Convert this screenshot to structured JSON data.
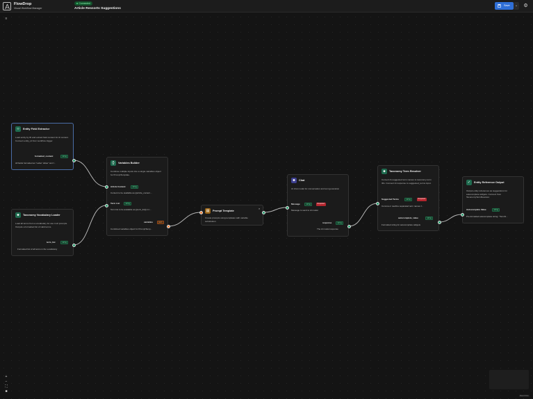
{
  "app": {
    "title": "FlowDrop",
    "subtitle": "Visual Workflow Manager"
  },
  "header": {
    "status": "Connected",
    "workflow_title": "Article Ressorts Suggestions",
    "save_label": "Save",
    "more_icon": "chevron-down-icon",
    "settings_icon": "gear-icon"
  },
  "colors": {
    "accent": "#2f6fd6",
    "connected": "#4ade80",
    "string_port": "#2ba271",
    "json_port": "#f0833a",
    "required": "#b3262e",
    "node_border": "#333333"
  },
  "nodes": {
    "entity_field_extractor": {
      "title": "Entity Field Extractor",
      "icon": "code-icon",
      "description": "Load entity by ID and extract field content for AI context. Connect entity_id from workflow trigger.",
      "output_label": "formatted_content",
      "output_type": "string",
      "output_desc": "All fields formatted as \"Label: Value\" text f..."
    },
    "taxonomy_vocabulary_loader": {
      "title": "Taxonomy Vocabulary Loader",
      "icon": "tag-icon",
      "description": "Load all terms from a vocabulary for use in AI prompts. Outputs a formatted list of valid terms.",
      "output_label": "term_list",
      "output_type": "string",
      "output_desc": "Formatted list of all terms in the vocabulary"
    },
    "variables_builder": {
      "title": "Variables Builder",
      "icon": "braces-icon",
      "description": "Combine multiple inputs into a single variables object for PromptTemplate.",
      "input1_label": "Article Content",
      "input1_type": "string",
      "input1_desc": "Content to be available as {{article_content...",
      "input2_label": "Term List",
      "input2_type": "string",
      "input2_desc": "Term list to be available as {{term_list}} in t...",
      "output_label": "variables",
      "output_type": "json",
      "output_desc": "Combined variables object for PromptTemp..."
    },
    "prompt_template": {
      "title": "Prompt Template",
      "icon": "template-icon",
      "close_icon": "close-icon",
      "description": "Create prompts using templates with variable substitution"
    },
    "chat": {
      "title": "Chat",
      "icon": "robot-icon",
      "description": "AI chat model for conversation and text generation",
      "input_label": "Message",
      "input_type": "string",
      "input_required": "Required",
      "input_desc": "Message to send to AI model",
      "output_label": "response",
      "output_type": "string",
      "output_desc": "The AI model response"
    },
    "taxonomy_term_resolver": {
      "title": "Taxonomy Term Resolver",
      "icon": "tags-icon",
      "description": "Convert AI-suggested term names to taxonomy term IDs. Connect AI response to suggested_terms input.",
      "input_label": "Suggested Terms",
      "input_type": "string",
      "input_required": "Required",
      "input_desc": "Comma or newline separated term names f...",
      "output_label": "autocomplete_value",
      "output_type": "string",
      "output_desc": "Formatted string for autocomplete widgets"
    },
    "entity_reference_output": {
      "title": "Entity Reference Output",
      "icon": "check-square-icon",
      "description": "Output entity references as suggestions for autocomplete widgets. Connect from TaxonomyTermResolver.",
      "input_label": "Autocomplete Value",
      "input_type": "string",
      "input_desc": "Pre-formatted autocomplete string: \"TermN..."
    }
  },
  "controls": {
    "zoom_in": "+",
    "zoom_out": "−",
    "fit": "fit-view-icon",
    "lock": "lock-icon"
  },
  "attribution": "React Flow"
}
